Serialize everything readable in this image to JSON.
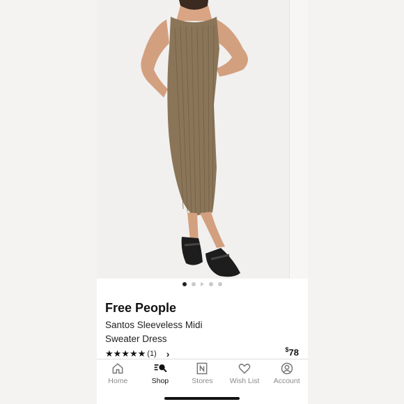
{
  "product": {
    "brand": "Free People",
    "name_line1": "Santos Sleeveless Midi",
    "name_line2": "Sweater Dress",
    "rating_stars": 5,
    "rating_count": "(1)",
    "price_symbol": "$",
    "price_value": "78",
    "image_icon": "product-photo"
  },
  "carousel": {
    "count": 5,
    "active_index": 0
  },
  "tabbar": {
    "items": [
      {
        "label": "Home",
        "icon": "home-icon",
        "active": false
      },
      {
        "label": "Shop",
        "icon": "shop-search-icon",
        "active": true
      },
      {
        "label": "Stores",
        "icon": "store-icon",
        "active": false
      },
      {
        "label": "Wish List",
        "icon": "heart-icon",
        "active": false
      },
      {
        "label": "Account",
        "icon": "account-icon",
        "active": false
      }
    ]
  },
  "colors": {
    "dress": "#8a7558",
    "active_tab": "#111111",
    "inactive_tab": "#8a8a8a"
  }
}
